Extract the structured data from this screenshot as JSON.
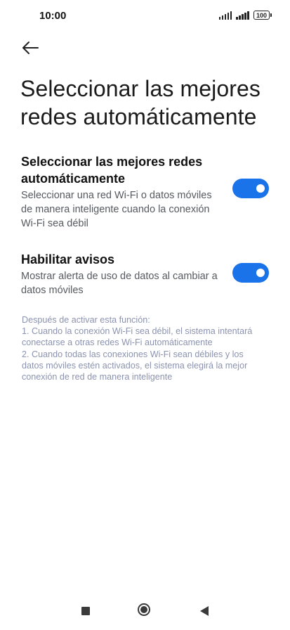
{
  "status_bar": {
    "time": "10:00",
    "battery": "100",
    "icons": [
      "signal-icon",
      "signal-icon",
      "battery-icon"
    ]
  },
  "header": {
    "back_icon": "arrow-left-icon",
    "title": "Seleccionar las mejores redes automáticamente"
  },
  "settings": [
    {
      "title": "Seleccionar las mejores redes automáticamente",
      "description": "Seleccionar una red Wi-Fi o datos móviles de manera inteligente cuando la conexión Wi-Fi sea débil",
      "enabled": true
    },
    {
      "title": "Habilitar avisos",
      "description": "Mostrar alerta de uso de datos al cambiar a datos móviles",
      "enabled": true
    }
  ],
  "info_note": {
    "lines": [
      "Después de activar esta función:",
      "1. Cuando la conexión Wi-Fi sea débil, el sistema intentará conectarse a otras redes Wi-Fi automáticamente",
      "2. Cuando todas las conexiones Wi-Fi sean débiles y los datos móviles estén activados, el sistema elegirá la mejor conexión de red de manera inteligente"
    ]
  },
  "colors": {
    "toggle_on": "#1a73e8",
    "note_text": "#8b93b0",
    "description_text": "#555a60"
  },
  "nav_bar": {
    "icons": [
      "recents-square-icon",
      "home-circle-icon",
      "back-triangle-icon"
    ]
  }
}
